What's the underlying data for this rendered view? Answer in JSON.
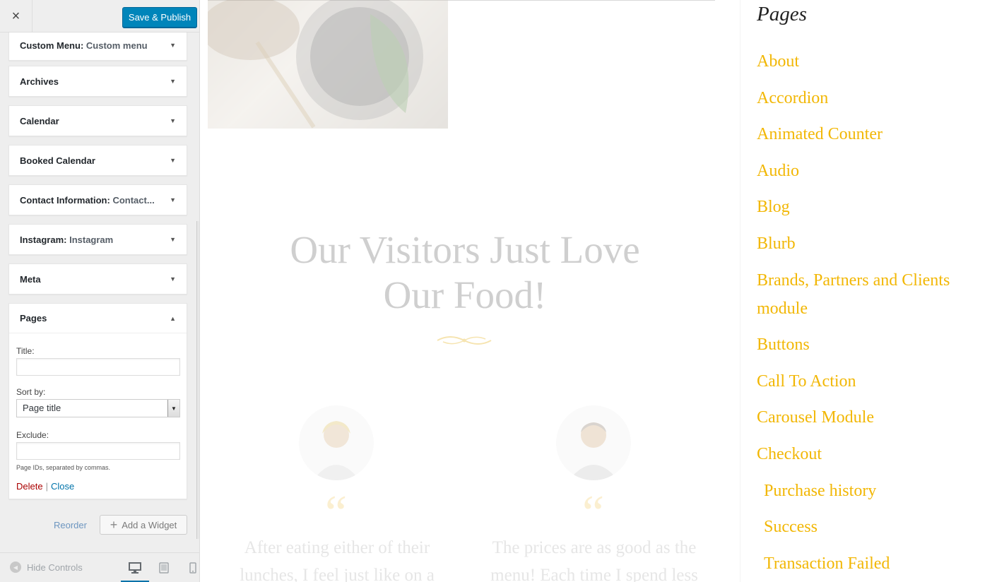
{
  "header": {
    "close_label": "×",
    "publish_label": "Save & Publish"
  },
  "widgets": [
    {
      "title": "Custom Menu",
      "subtitle": "Custom menu"
    },
    {
      "title": "Archives",
      "subtitle": ""
    },
    {
      "title": "Calendar",
      "subtitle": ""
    },
    {
      "title": "Booked Calendar",
      "subtitle": ""
    },
    {
      "title": "Contact Information",
      "subtitle": "Contact..."
    },
    {
      "title": "Instagram",
      "subtitle": "Instagram"
    },
    {
      "title": "Meta",
      "subtitle": ""
    }
  ],
  "pages_widget": {
    "title": "Pages",
    "title_label": "Title:",
    "title_value": "",
    "sortby_label": "Sort by:",
    "sortby_value": "Page title",
    "exclude_label": "Exclude:",
    "exclude_value": "",
    "exclude_note": "Page IDs, separated by commas.",
    "delete_label": "Delete",
    "separator": "|",
    "close_label": "Close"
  },
  "actions": {
    "reorder_label": "Reorder",
    "add_widget_label": "Add a Widget"
  },
  "footer": {
    "hide_controls_label": "Hide Controls",
    "device_icons": [
      "desktop-icon",
      "tablet-icon",
      "mobile-icon"
    ]
  },
  "preview": {
    "heading_line1": "Our Visitors Just Love",
    "heading_line2": "Our Food!",
    "quote_mark": "“",
    "testimonial1": "After eating either of their lunches, I feel just like on a",
    "testimonial2": "The prices are as good as the menu! Each time I spend less",
    "sidebar_title": "Pages",
    "pages": [
      {
        "label": "About",
        "child": false
      },
      {
        "label": "Accordion",
        "child": false
      },
      {
        "label": "Animated Counter",
        "child": false
      },
      {
        "label": "Audio",
        "child": false
      },
      {
        "label": "Blog",
        "child": false
      },
      {
        "label": "Blurb",
        "child": false
      },
      {
        "label": "Brands, Partners and Clients module",
        "child": false
      },
      {
        "label": "Buttons",
        "child": false
      },
      {
        "label": "Call To Action",
        "child": false
      },
      {
        "label": "Carousel Module",
        "child": false
      },
      {
        "label": "Checkout",
        "child": false
      },
      {
        "label": "Purchase history",
        "child": true
      },
      {
        "label": "Success",
        "child": true
      },
      {
        "label": "Transaction Failed",
        "child": true
      }
    ]
  },
  "colors": {
    "accent": "#0085ba",
    "link_gold": "#f2b705",
    "delete_red": "#aa0000",
    "link_blue": "#0073aa"
  }
}
